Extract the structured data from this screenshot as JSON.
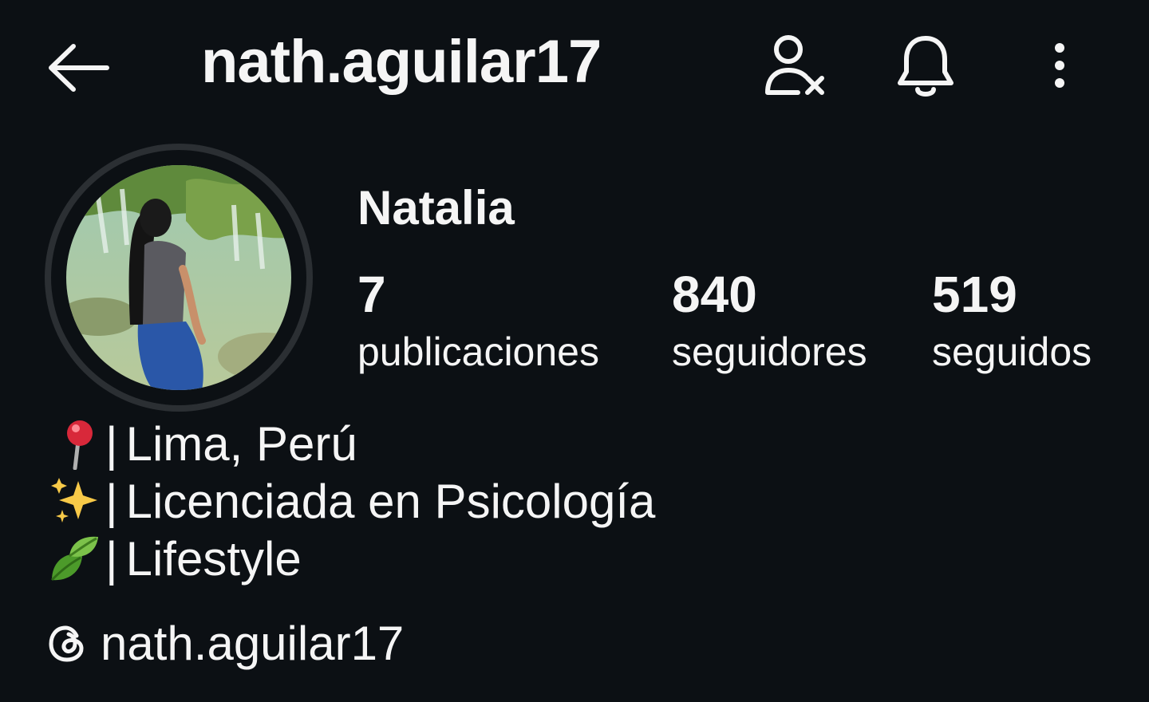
{
  "header": {
    "username": "nath.aguilar17",
    "back_icon": "arrow-left-icon",
    "unfollow_icon": "user-remove-icon",
    "notifications_icon": "bell-icon",
    "more_icon": "more-vertical-icon"
  },
  "profile": {
    "display_name": "Natalia",
    "avatar": "profile-photo",
    "stats": [
      {
        "value": "7",
        "label": "publicaciones"
      },
      {
        "value": "840",
        "label": "seguidores"
      },
      {
        "value": "519",
        "label": "seguidos"
      }
    ],
    "bio": [
      {
        "emoji": "pin-icon",
        "separator": "|",
        "text": "Lima, Perú"
      },
      {
        "emoji": "sparkles-icon",
        "separator": "|",
        "text": "Licenciada en Psicología"
      },
      {
        "emoji": "leaf-icon",
        "separator": "|",
        "text": "Lifestyle"
      }
    ],
    "threads": {
      "icon": "threads-icon",
      "handle": "nath.aguilar17"
    }
  },
  "colors": {
    "background": "#0c1014",
    "text": "#f5f5f5",
    "avatar_ring": "#2b2f33"
  }
}
